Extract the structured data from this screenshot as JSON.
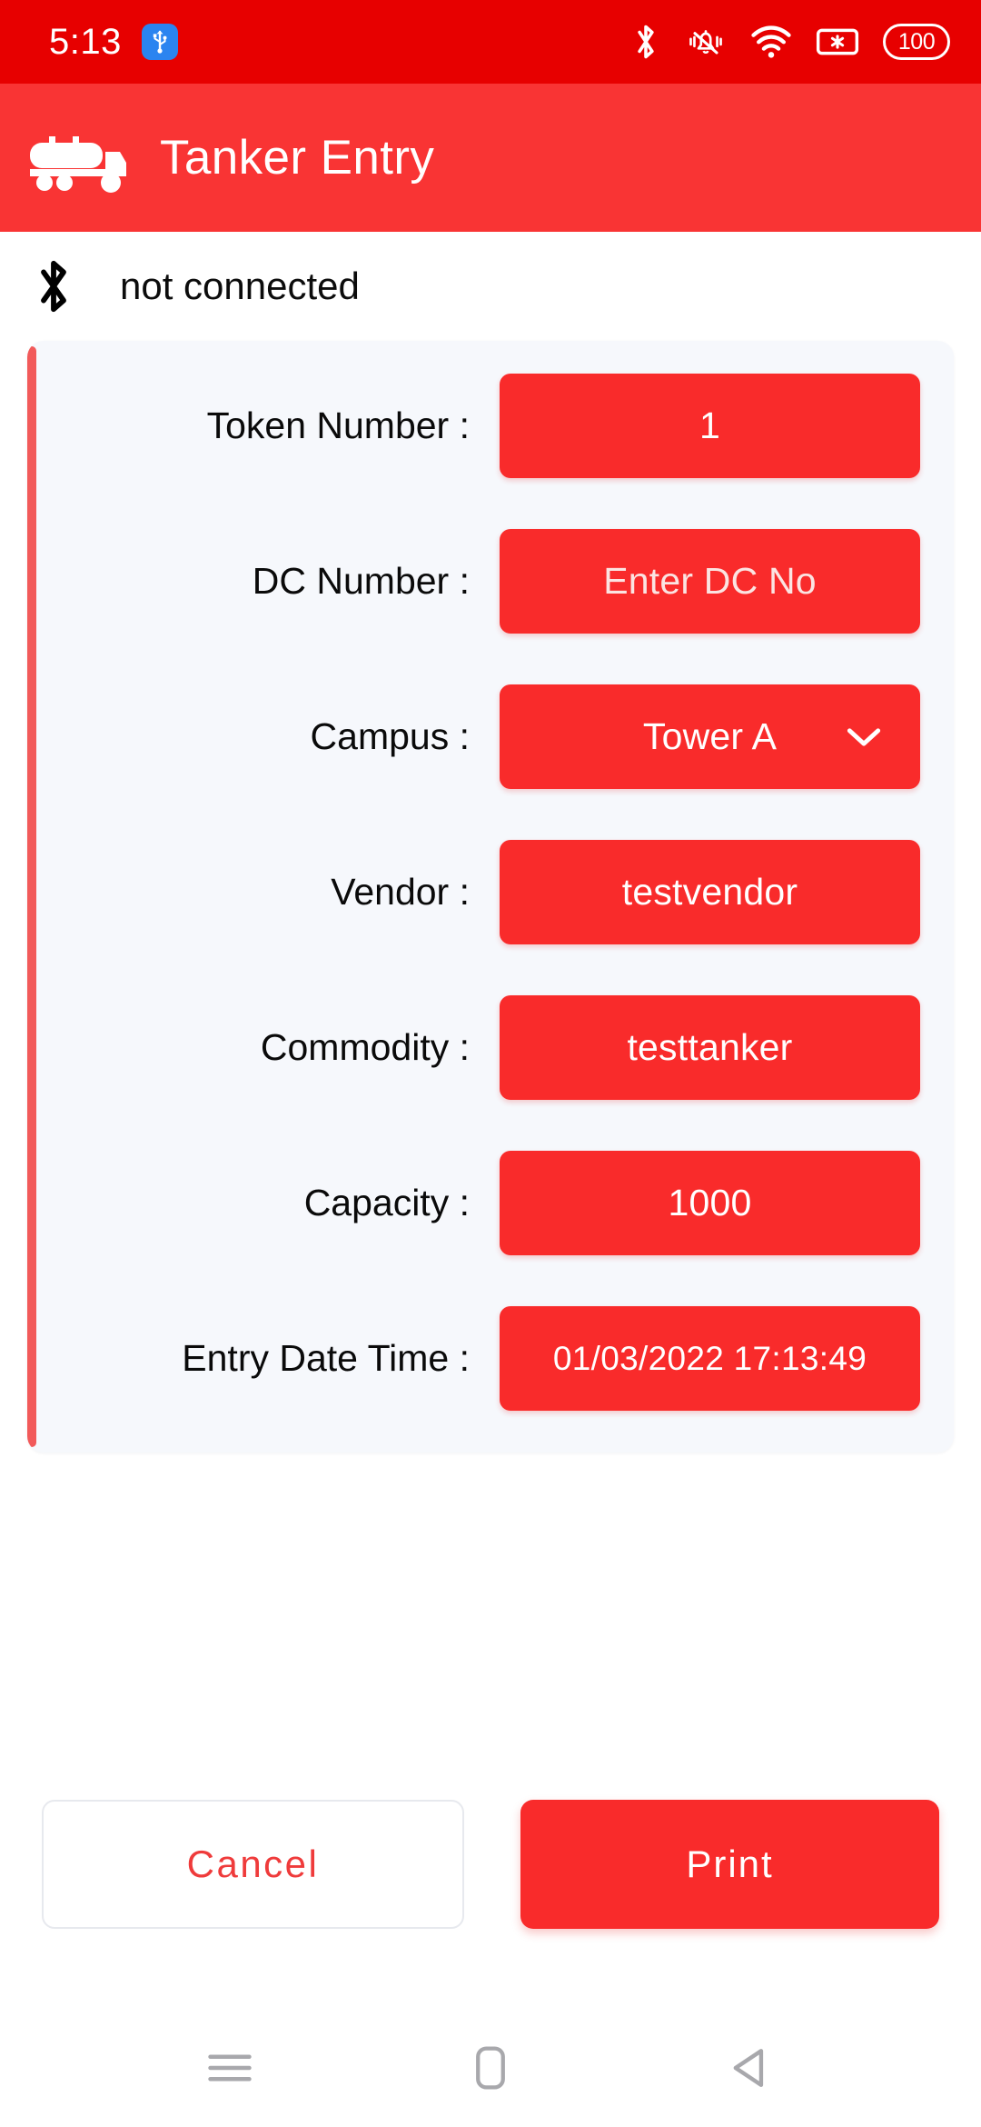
{
  "status_bar": {
    "time": "5:13",
    "usb_icon": "usb-icon",
    "bluetooth_icon": "bluetooth-icon",
    "ringer_muted_icon": "bell-muted-icon",
    "wifi_icon": "wifi-icon",
    "sim_icon": "sim-card-icon",
    "battery_level": "100",
    "background_color": "#e70000"
  },
  "app_bar": {
    "title": "Tanker Entry",
    "logo_icon": "tanker-truck-icon",
    "background_color": "#f93434"
  },
  "connection": {
    "icon": "bluetooth-icon",
    "status_text": "not connected"
  },
  "form": {
    "accent_color": "#f25a5a",
    "field_color": "#f92b2b",
    "rows": [
      {
        "label": "Token Number :",
        "value": "1",
        "type": "text",
        "is_placeholder": false
      },
      {
        "label": "DC Number :",
        "value": "Enter DC No",
        "type": "text",
        "is_placeholder": true
      },
      {
        "label": "Campus :",
        "value": "Tower A",
        "type": "dropdown",
        "is_placeholder": false,
        "icon": "chevron-down-icon"
      },
      {
        "label": "Vendor :",
        "value": "testvendor",
        "type": "text",
        "is_placeholder": false
      },
      {
        "label": "Commodity :",
        "value": "testtanker",
        "type": "text",
        "is_placeholder": false
      },
      {
        "label": "Capacity :",
        "value": "1000",
        "type": "text",
        "is_placeholder": false
      },
      {
        "label": "Entry Date Time :",
        "value": "01/03/2022 17:13:49",
        "type": "datetime",
        "is_placeholder": false
      }
    ]
  },
  "actions": {
    "cancel_label": "Cancel",
    "print_label": "Print",
    "cancel_color": "#ef3b3b",
    "print_color": "#f92b2b"
  },
  "nav_bar": {
    "recents_icon": "menu-icon",
    "home_icon": "home-square-icon",
    "back_icon": "back-triangle-icon"
  }
}
